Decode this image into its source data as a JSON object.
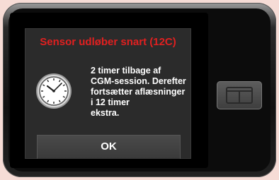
{
  "dialog": {
    "title": "Sensor udløber snart (12C)",
    "message_lines": [
      "2 timer tilbage af",
      "CGM-session. Derefter",
      "fortsætter aflæsninger",
      "i 12 timer",
      "ekstra."
    ],
    "ok_label": "OK",
    "icon": "clock-icon"
  },
  "device": {
    "home_button_icon": "t-logo-icon"
  },
  "colors": {
    "title": "#e02020",
    "dialog_bg": "#2b2b2b",
    "page_bg": "#f6dcd6"
  }
}
